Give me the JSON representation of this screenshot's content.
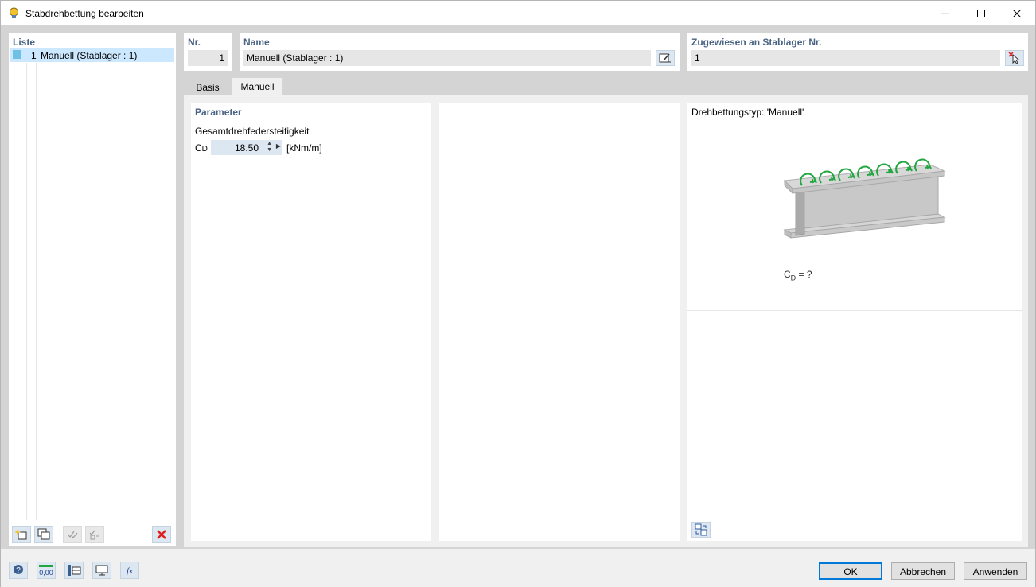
{
  "window": {
    "title": "Stabdrehbettung bearbeiten",
    "app_icon": "app-bulb-icon",
    "controls": [
      "minimize-icon",
      "maximize-icon",
      "close-icon"
    ]
  },
  "list": {
    "header": "Liste",
    "items": [
      {
        "number": "1",
        "label": "Manuell (Stablager : 1)",
        "color": "#6ec1e4",
        "selected": true
      }
    ],
    "tools": [
      {
        "icon": "new-item-icon",
        "enabled": true
      },
      {
        "icon": "copy-item-icon",
        "enabled": true
      },
      {
        "icon": "check-all-icon",
        "enabled": false
      },
      {
        "icon": "uncheck-icon",
        "enabled": false
      },
      {
        "icon": "delete-icon",
        "enabled": true
      }
    ]
  },
  "nr": {
    "label": "Nr.",
    "value": "1"
  },
  "name": {
    "label": "Name",
    "value": "Manuell (Stablager : 1)",
    "edit_icon": "edit-name-icon"
  },
  "assigned": {
    "label": "Zugewiesen an Stablager Nr.",
    "value": "1",
    "pick_icon": "pick-cursor-icon"
  },
  "tabs": [
    {
      "label": "Basis",
      "active": false
    },
    {
      "label": "Manuell",
      "active": true
    }
  ],
  "parameters": {
    "header": "Parameter",
    "stiffness_label": "Gesamtdrehfedersteifigkeit",
    "symbol": "C",
    "symbol_sub": "D",
    "value": "18.50",
    "unit": "[kNm/m]"
  },
  "preview": {
    "title": "Drehbettungstyp: 'Manuell'",
    "caption_symbol": "C",
    "caption_sub": "D",
    "caption_rest": "= ?",
    "spring_color": "#21a640",
    "beam_color": "#c0c0c0",
    "tool_icon": "swap-view-icon"
  },
  "bottom_icons": [
    "help-icon",
    "units-icon",
    "info-table-icon",
    "display-icon",
    "function-icon"
  ],
  "units_icon_text": "0,00",
  "function_icon_text": "fx",
  "buttons": {
    "ok": "OK",
    "cancel": "Abbrechen",
    "apply": "Anwenden"
  }
}
